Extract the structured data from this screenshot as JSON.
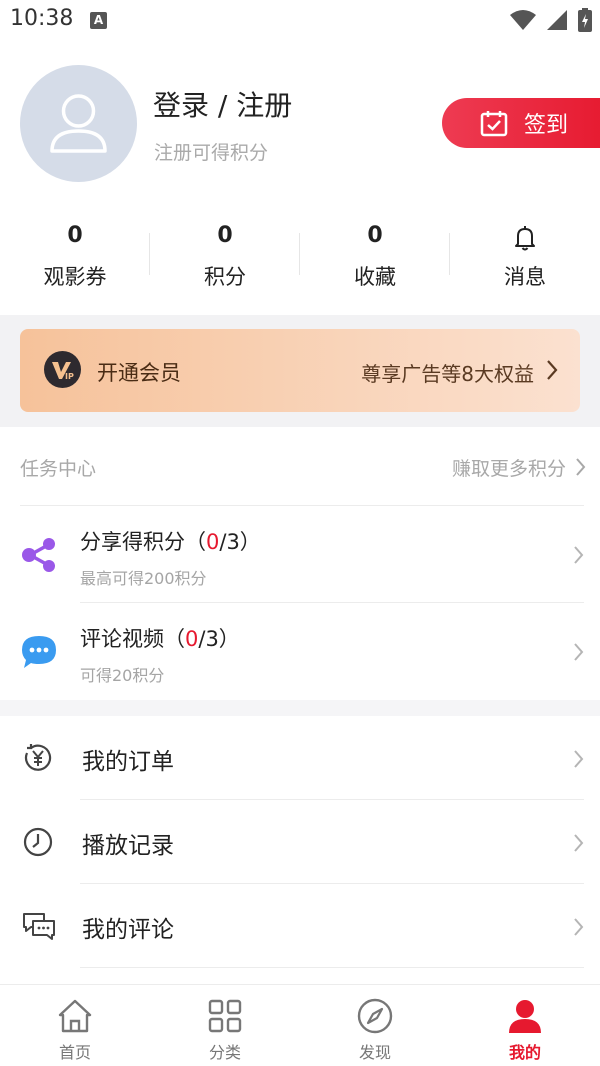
{
  "status_bar": {
    "time": "10:38",
    "notification_letter": "A"
  },
  "profile": {
    "title": "登录 / 注册",
    "subtitle": "注册可得积分"
  },
  "checkin": {
    "label": "签到"
  },
  "stats": [
    {
      "value": "0",
      "label": "观影券"
    },
    {
      "value": "0",
      "label": "积分"
    },
    {
      "value": "0",
      "label": "收藏"
    },
    {
      "icon": "bell-icon",
      "label": "消息"
    }
  ],
  "vip": {
    "title": "开通会员",
    "benefit": "尊享广告等8大权益"
  },
  "tasks": {
    "header": "任务中心",
    "more": "赚取更多积分",
    "items": [
      {
        "title_prefix": "分享得积分（",
        "done": "0",
        "title_suffix": "/3）",
        "subtitle": "最高可得200积分",
        "icon": "share-icon"
      },
      {
        "title_prefix": "评论视频（",
        "done": "0",
        "title_suffix": "/3）",
        "subtitle": "可得20积分",
        "icon": "comment-bubble-icon"
      }
    ]
  },
  "menu": [
    {
      "label": "我的订单",
      "icon": "yuan-order-icon"
    },
    {
      "label": "播放记录",
      "icon": "clock-icon"
    },
    {
      "label": "我的评论",
      "icon": "comments-icon"
    }
  ],
  "tabbar": [
    {
      "label": "首页",
      "icon": "home-icon"
    },
    {
      "label": "分类",
      "icon": "category-grid-icon"
    },
    {
      "label": "发现",
      "icon": "compass-icon"
    },
    {
      "label": "我的",
      "icon": "user-icon",
      "active": true
    }
  ],
  "colors": {
    "accent": "#e6192f",
    "vip_gradient_start": "#f6c29a",
    "vip_gradient_end": "#fbe1d0"
  }
}
